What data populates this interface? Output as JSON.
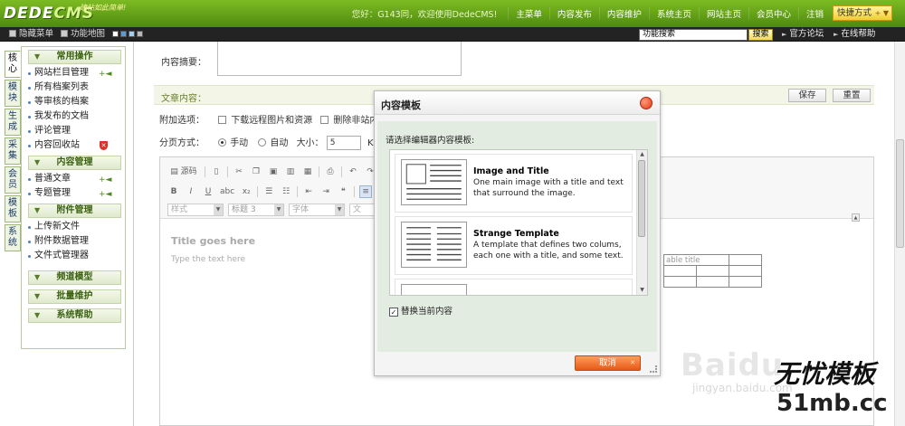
{
  "header": {
    "logo_main": "DEDE",
    "logo_cms": "CMS",
    "logo_slogan": "建站如此简单!",
    "greeting": "您好：G143同，欢迎使用DedeCMS!",
    "nav": [
      "主菜单",
      "内容发布",
      "内容维护",
      "系统主页",
      "网站主页",
      "会员中心",
      "注销"
    ],
    "quick_menu": "快捷方式"
  },
  "subbar": {
    "hide_menu": "隐藏菜单",
    "function_map": "功能地图",
    "swatch_colors": [
      "#ffffff",
      "#5b9bd5",
      "#9fd0f0",
      "#b8b8b8"
    ],
    "search_value": "功能搜索",
    "search_button": "搜索",
    "forum_link": "官方论坛",
    "help_link": "在线帮助"
  },
  "left_tabs": [
    "核心",
    "模块",
    "生成",
    "采集",
    "会员",
    "模板",
    "系统"
  ],
  "left_menu": {
    "sections": [
      {
        "title": "常用操作",
        "items": [
          "网站栏目管理",
          "所有档案列表",
          "等审核的档案",
          "我发布的文档",
          "评论管理",
          "内容回收站"
        ]
      },
      {
        "title": "内容管理",
        "items": [
          "普通文章",
          "专题管理"
        ]
      },
      {
        "title": "附件管理",
        "items": [
          "上传新文件",
          "附件数据管理",
          "文件式管理器"
        ]
      },
      {
        "title": "频道模型",
        "items": []
      },
      {
        "title": "批量维护",
        "items": []
      },
      {
        "title": "系统帮助",
        "items": []
      }
    ]
  },
  "form": {
    "summary_label": "内容摘要：",
    "article_label": "文章内容：",
    "save_label": "保存",
    "reset_label": "重置",
    "options_label": "附加选项：",
    "option_download_remote": "下载远程图片和资源",
    "option_remove_links": "删除非站内链",
    "paging_label": "分页方式：",
    "paging_manual": "手动",
    "paging_auto": "自动",
    "size_label": "大小：",
    "size_value": "5",
    "size_unit": "K"
  },
  "editor": {
    "source_label": "源码",
    "style_placeholder": "样式",
    "format_value": "标题 3",
    "font_placeholder": "字体",
    "size_placeholder": "文",
    "content_title": "Title goes here",
    "content_text": "Type the text here",
    "table_title": "able title"
  },
  "modal": {
    "title": "内容模板",
    "instruction": "请选择编辑器内容模板:",
    "templates": [
      {
        "name": "Image and Title",
        "desc": "One main image with a title and text that surround the image."
      },
      {
        "name": "Strange Template",
        "desc": "A template that defines two colums, each one with a title, and some text."
      }
    ],
    "replace_label": "替换当前内容",
    "replace_checked": "✓",
    "cancel_label": "取消"
  },
  "watermarks": {
    "baidu": "Baidu",
    "jingyan": "jingyan.baidu.com",
    "brand": "无忧模板",
    "site": "51mb.cc"
  }
}
